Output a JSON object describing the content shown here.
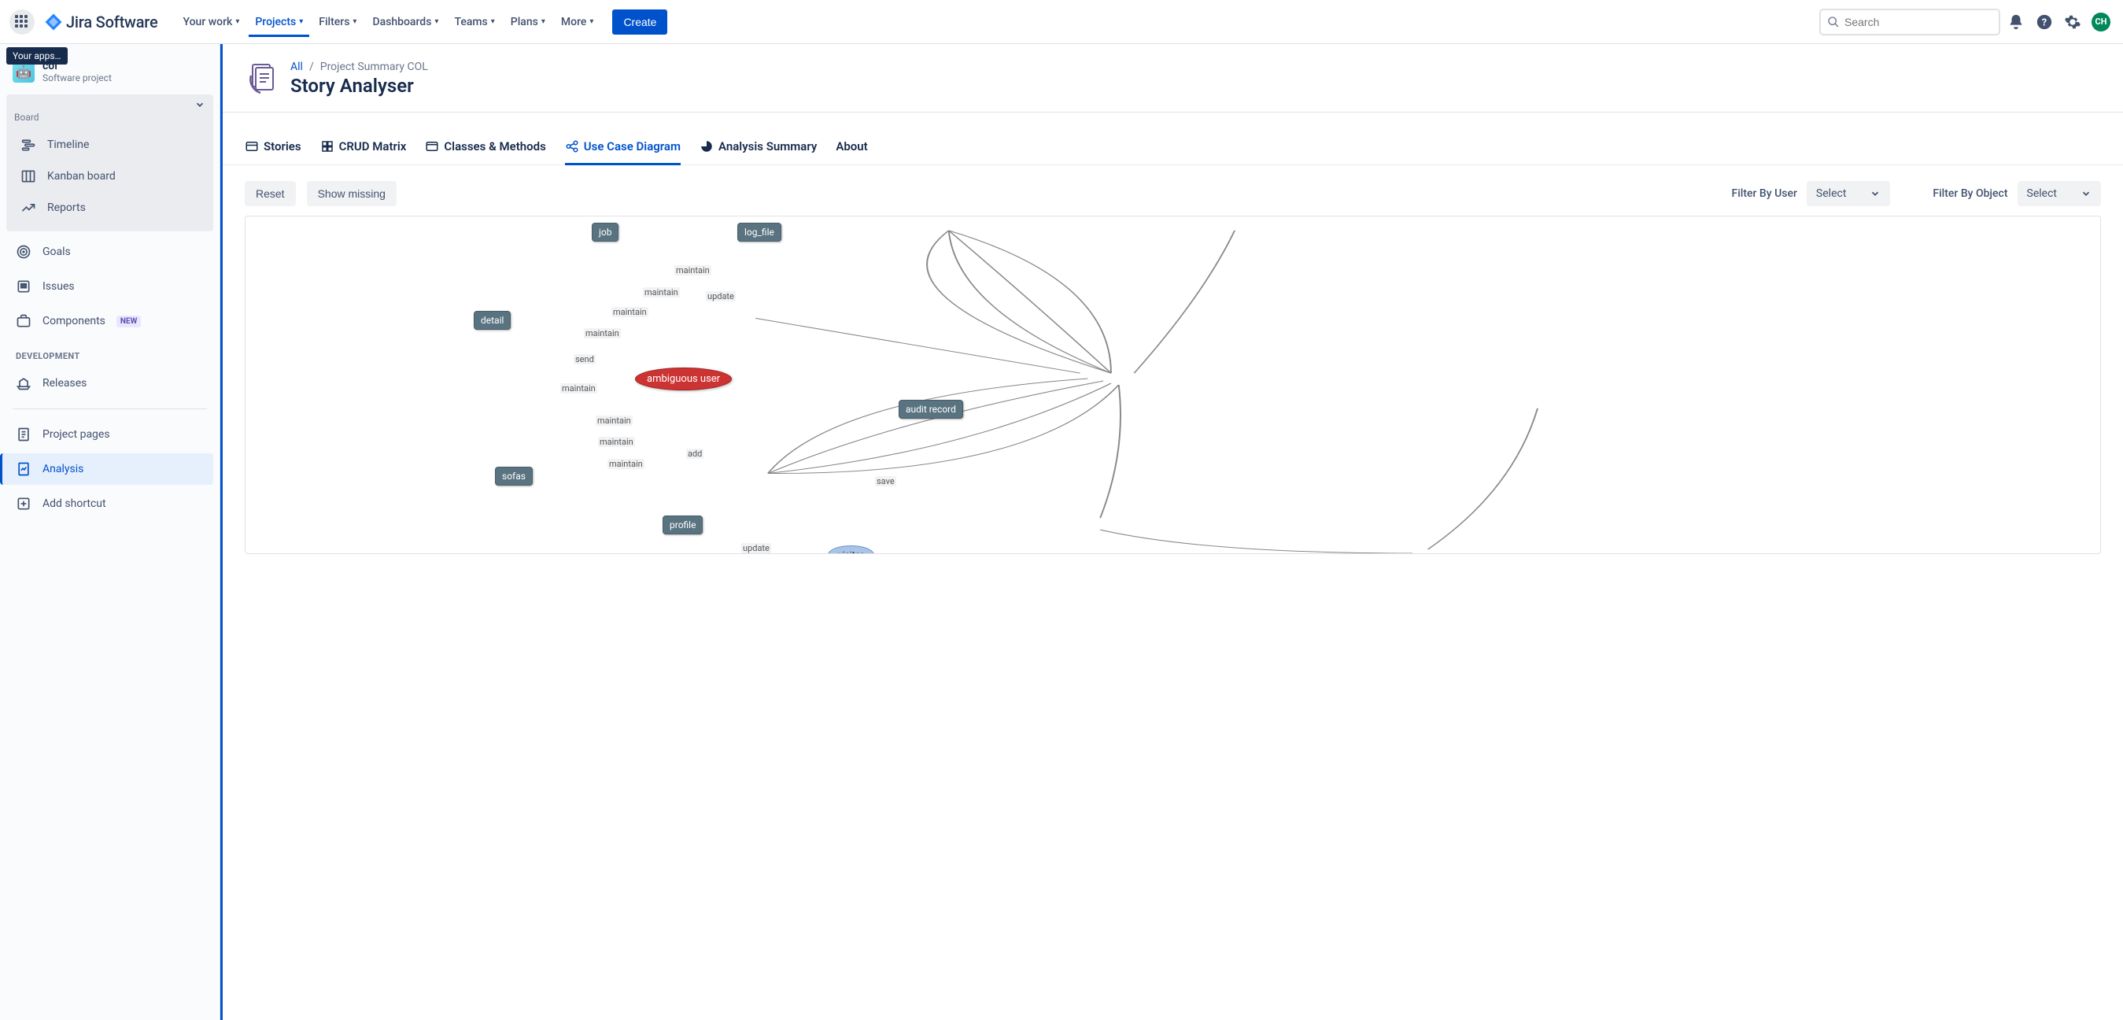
{
  "nav": {
    "logo_text": "Jira Software",
    "your_work": "Your work",
    "projects": "Projects",
    "filters": "Filters",
    "dashboards": "Dashboards",
    "teams": "Teams",
    "plans": "Plans",
    "more": "More",
    "create": "Create",
    "search_placeholder": "Search",
    "avatar_initials": "CH",
    "tooltip": "Your apps…"
  },
  "sidebar": {
    "project_name": "col",
    "project_type": "Software project",
    "board_name_truncated": "",
    "board_label": "Board",
    "items": {
      "timeline": "Timeline",
      "kanban": "Kanban board",
      "reports": "Reports",
      "goals": "Goals",
      "issues": "Issues",
      "components": "Components",
      "new_badge": "NEW",
      "section_dev": "DEVELOPMENT",
      "releases": "Releases",
      "project_pages": "Project pages",
      "analysis": "Analysis",
      "add_shortcut": "Add shortcut"
    }
  },
  "header": {
    "bc_all": "All",
    "bc_sep": "/",
    "bc_project": "Project Summary COL",
    "title": "Story Analyser"
  },
  "tabs": {
    "stories": "Stories",
    "crud": "CRUD Matrix",
    "classes": "Classes & Methods",
    "usecase": "Use Case Diagram",
    "summary": "Analysis Summary",
    "about": "About"
  },
  "toolbar": {
    "reset": "Reset",
    "show_missing": "Show missing",
    "filter_user": "Filter By User",
    "filter_object": "Filter By Object",
    "select": "Select"
  },
  "diagram": {
    "nodes": {
      "job": "job",
      "log_file": "log_file",
      "detail": "detail",
      "ambiguous_user": "ambiguous user",
      "sofas": "sofas",
      "profile": "profile",
      "audit_record": "audit record",
      "visitor": "visitor"
    },
    "edge_labels": {
      "maintain1": "maintain",
      "maintain2": "maintain",
      "maintain3": "maintain",
      "maintain4": "maintain",
      "maintain5": "maintain",
      "maintain6": "maintain",
      "maintain7": "maintain",
      "maintain8": "maintain",
      "update1": "update",
      "send": "send",
      "add": "add",
      "update2": "update",
      "save": "save"
    }
  }
}
